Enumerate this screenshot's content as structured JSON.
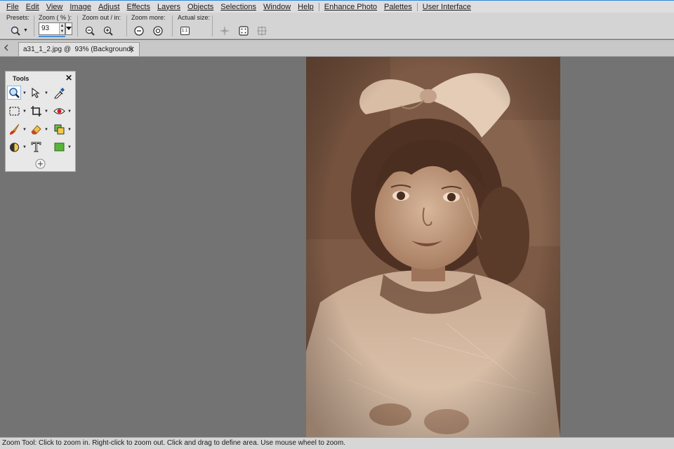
{
  "menu": [
    "File",
    "Edit",
    "View",
    "Image",
    "Adjust",
    "Effects",
    "Layers",
    "Objects",
    "Selections",
    "Window",
    "Help",
    "Enhance Photo",
    "Palettes",
    "User Interface"
  ],
  "toolbar": {
    "presets_label": "Presets:",
    "zoom_label": "Zoom ( % ):",
    "zoom_value": "93",
    "zoom_out_in_label": "Zoom out / in:",
    "zoom_more_label": "Zoom more:",
    "actual_size_label": "Actual size:",
    "actual_size_icon_text": "1:1"
  },
  "tab": {
    "title": "a31_1_2.jpg @  93% (Background)",
    "close": "✕"
  },
  "tools_palette": {
    "title": "Tools",
    "close": "✕",
    "tools": [
      "zoom-tool-icon",
      "pick-tool-icon",
      "dropper-tool-icon",
      "selection-tool-icon",
      "crop-tool-icon",
      "red-eye-tool-icon",
      "paint-brush-tool-icon",
      "eraser-tool-icon",
      "clone-tool-icon",
      "dodge-tool-icon",
      "text-tool-icon",
      "shape-tool-icon",
      "add-tool-icon"
    ]
  },
  "colors": {
    "accent": "#2e8ad8",
    "canvas_bg": "#737373",
    "shape_fill": "#5bb33a"
  },
  "status": "Zoom Tool: Click to zoom in. Right-click to zoom out. Click and drag to define area. Use mouse wheel to zoom."
}
